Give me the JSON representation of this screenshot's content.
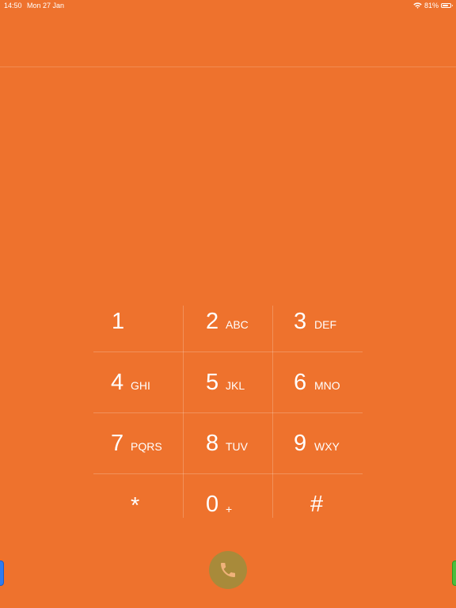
{
  "status_bar": {
    "time": "14:50",
    "date": "Mon 27 Jan",
    "battery_percent": "81%",
    "battery_level": 0.81,
    "wifi_icon": "wifi-icon",
    "battery_icon": "battery-icon"
  },
  "keypad": {
    "keys": [
      {
        "digit": "1",
        "letters": ""
      },
      {
        "digit": "2",
        "letters": "ABC"
      },
      {
        "digit": "3",
        "letters": "DEF"
      },
      {
        "digit": "4",
        "letters": "GHI"
      },
      {
        "digit": "5",
        "letters": "JKL"
      },
      {
        "digit": "6",
        "letters": "MNO"
      },
      {
        "digit": "7",
        "letters": "PQRS"
      },
      {
        "digit": "8",
        "letters": "TUV"
      },
      {
        "digit": "9",
        "letters": "WXY"
      },
      {
        "digit": "*",
        "letters": ""
      },
      {
        "digit": "0",
        "letters": "+"
      },
      {
        "digit": "#",
        "letters": ""
      }
    ]
  },
  "call_button": {
    "icon": "phone-icon"
  },
  "colors": {
    "background": "#ee722d",
    "call_button": "#a88a3a",
    "phone_icon": "#f0b27a",
    "edge_left": "#2f7bf0",
    "edge_right": "#4bbd3c"
  }
}
